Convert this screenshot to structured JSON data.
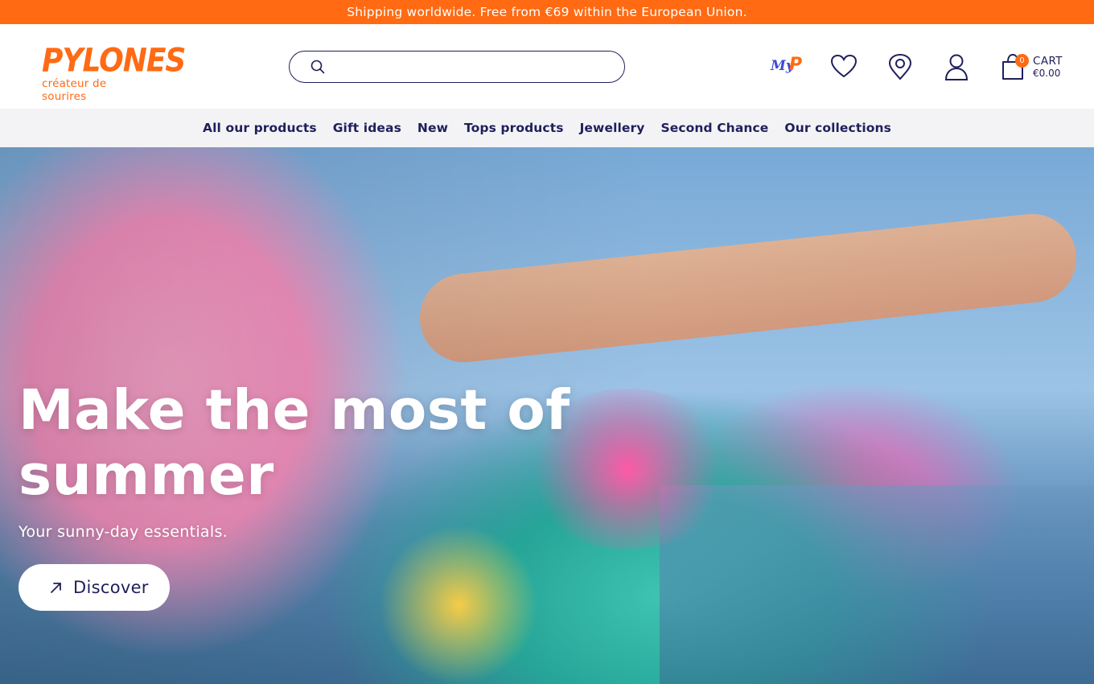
{
  "promo": {
    "text": "Shipping worldwide. Free from €69 within the European Union."
  },
  "header": {
    "logo": {
      "word": "PYLONES",
      "tagline": "créateur de sourires"
    },
    "search": {
      "value": "",
      "placeholder": "",
      "icon": "search-icon"
    },
    "icons": {
      "loyalty_logo": {
        "my": "My",
        "p": "P"
      },
      "wishlist": "heart-icon",
      "stores": "location-pin-icon",
      "account": "user-icon"
    },
    "cart": {
      "count": "0",
      "label": "CART",
      "total": "€0.00",
      "icon": "shopping-bag-icon"
    }
  },
  "nav": {
    "items": [
      {
        "label": "All our products"
      },
      {
        "label": "Gift ideas"
      },
      {
        "label": "New"
      },
      {
        "label": "Tops products"
      },
      {
        "label": "Jewellery"
      },
      {
        "label": "Second Chance"
      },
      {
        "label": "Our collections"
      }
    ]
  },
  "hero": {
    "title": "Make the most of summer",
    "subtitle": "Your sunny-day essentials.",
    "cta": {
      "label": "Discover",
      "icon": "arrow-up-right-icon"
    }
  },
  "colors": {
    "brand_orange": "#ff6a13",
    "navy": "#1f1f5c",
    "nav_bg": "#f3f3f5"
  }
}
